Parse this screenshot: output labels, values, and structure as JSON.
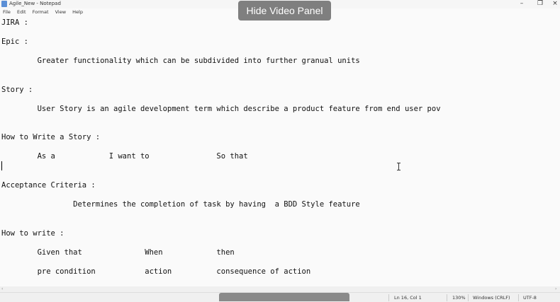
{
  "window": {
    "title": "Agile_New - Notepad",
    "minimize": "–",
    "maximize": "❐",
    "close": "×"
  },
  "menu": [
    "File",
    "Edit",
    "Format",
    "View",
    "Help"
  ],
  "overlay": {
    "hide_video_panel": "Hide Video Panel"
  },
  "editor": {
    "lines": [
      "JIRA :",
      "Epic :",
      "        Greater functionality which can be subdivided into further granual units",
      "Story :",
      "        User Story is an agile development term which describe a product feature from end user pov",
      "How to Write a Story :",
      "        As a            I want to               So that",
      "Acceptance Criteria :",
      "                Determines the completion of task by having  a BDD Style feature",
      "How to write :",
      "        Given that              When            then",
      "        pre condition           action          consequence of action"
    ]
  },
  "status": {
    "position": "Ln 16, Col 1",
    "zoom": "130%",
    "line_ending": "Windows (CRLF)",
    "encoding": "UTF-8"
  },
  "scroll": {
    "left_arrow": "‹",
    "right_arrow": "›"
  }
}
